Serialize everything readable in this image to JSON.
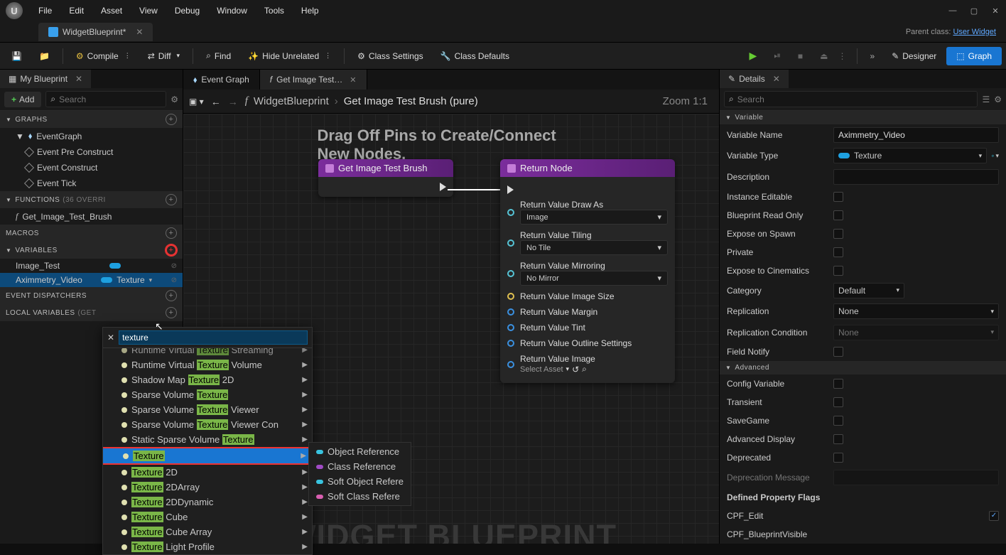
{
  "menu": [
    "File",
    "Edit",
    "Asset",
    "View",
    "Debug",
    "Window",
    "Tools",
    "Help"
  ],
  "file_tab": "WidgetBlueprint*",
  "parent_class_label": "Parent class:",
  "parent_class_value": "User Widget",
  "toolbar": {
    "compile": "Compile",
    "diff": "Diff",
    "find": "Find",
    "hide": "Hide Unrelated",
    "class_settings": "Class Settings",
    "class_defaults": "Class Defaults",
    "designer": "Designer",
    "graph": "Graph"
  },
  "my_blueprint_tab": "My Blueprint",
  "add_label": "Add",
  "search_placeholder": "Search",
  "sections": {
    "graphs": "GRAPHS",
    "functions": "FUNCTIONS",
    "functions_count": "(36 OVERRI",
    "macros": "MACROS",
    "variables": "VARIABLES",
    "event_dispatchers": "EVENT DISPATCHERS",
    "local_vars": "LOCAL VARIABLES",
    "local_vars_suffix": "(GET"
  },
  "graphs": {
    "root": "EventGraph",
    "items": [
      "Event Pre Construct",
      "Event Construct",
      "Event Tick"
    ]
  },
  "functions": [
    "Get_Image_Test_Brush"
  ],
  "variables": [
    {
      "name": "Image_Test"
    },
    {
      "name": "Aximmetry_Video",
      "type": "Texture",
      "selected": true
    }
  ],
  "center_tabs": [
    {
      "label": "Event Graph",
      "active": false
    },
    {
      "label": "Get Image Test…",
      "active": true
    }
  ],
  "breadcrumb": {
    "bp": "WidgetBlueprint",
    "fn": "Get Image Test Brush (pure)"
  },
  "zoom": "Zoom 1:1",
  "hint": "Drag Off Pins to Create/Connect New Nodes.",
  "watermark": "WIDGET BLUEPRINT",
  "node1": {
    "title": "Get Image Test Brush"
  },
  "node2": {
    "title": "Return Node",
    "draw_as_label": "Return Value Draw As",
    "draw_as": "Image",
    "tiling_label": "Return Value Tiling",
    "tiling": "No Tile",
    "mirroring_label": "Return Value Mirroring",
    "mirroring": "No Mirror",
    "image_size": "Return Value Image Size",
    "margin": "Return Value Margin",
    "tint": "Return Value Tint",
    "outline": "Return Value Outline Settings",
    "image_label": "Return Value Image",
    "image_value": "Select Asset"
  },
  "details": {
    "tab": "Details",
    "section_var": "Variable",
    "section_adv": "Advanced",
    "var_name_label": "Variable Name",
    "var_name": "Aximmetry_Video",
    "var_type_label": "Variable Type",
    "var_type": "Texture",
    "description": "Description",
    "instance_editable": "Instance Editable",
    "bp_readonly": "Blueprint Read Only",
    "expose_spawn": "Expose on Spawn",
    "private": "Private",
    "expose_cine": "Expose to Cinematics",
    "category_label": "Category",
    "category": "Default",
    "replication_label": "Replication",
    "replication": "None",
    "rep_cond_label": "Replication Condition",
    "rep_cond": "None",
    "field_notify": "Field Notify",
    "config_var": "Config Variable",
    "transient": "Transient",
    "savegame": "SaveGame",
    "adv_display": "Advanced Display",
    "deprecated": "Deprecated",
    "dep_msg": "Deprecation Message",
    "flags": "Defined Property Flags",
    "flag1": "CPF_Edit",
    "flag2": "CPF_BlueprintVisible"
  },
  "type_search": "texture",
  "type_items": [
    {
      "pre": "Runtime Virtual ",
      "hl": "Texture",
      "post": " Streaming",
      "cut": true
    },
    {
      "pre": "Runtime Virtual ",
      "hl": "Texture",
      "post": " Volume"
    },
    {
      "pre": "Shadow Map ",
      "hl": "Texture",
      "post": " 2D"
    },
    {
      "pre": "Sparse Volume ",
      "hl": "Texture",
      "post": ""
    },
    {
      "pre": "Sparse Volume ",
      "hl": "Texture",
      "post": " Viewer"
    },
    {
      "pre": "Sparse Volume ",
      "hl": "Texture",
      "post": " Viewer Con"
    },
    {
      "pre": "Static Sparse Volume ",
      "hl": "Texture",
      "post": ""
    },
    {
      "pre": "",
      "hl": "Texture",
      "post": "",
      "selected": true,
      "red": true
    },
    {
      "pre": "",
      "hl": "Texture",
      "post": " 2D"
    },
    {
      "pre": "",
      "hl": "Texture",
      "post": " 2DArray"
    },
    {
      "pre": "",
      "hl": "Texture",
      "post": " 2DDynamic"
    },
    {
      "pre": "",
      "hl": "Texture",
      "post": " Cube"
    },
    {
      "pre": "",
      "hl": "Texture",
      "post": " Cube Array"
    },
    {
      "pre": "",
      "hl": "Texture",
      "post": " Light Profile"
    }
  ],
  "submenu": [
    {
      "label": "Object Reference",
      "color": "#39c4e0"
    },
    {
      "label": "Class Reference",
      "color": "#a04bc4"
    },
    {
      "label": "Soft Object Refere",
      "color": "#39c4e0"
    },
    {
      "label": "Soft Class Refere",
      "color": "#d85fb0"
    }
  ]
}
